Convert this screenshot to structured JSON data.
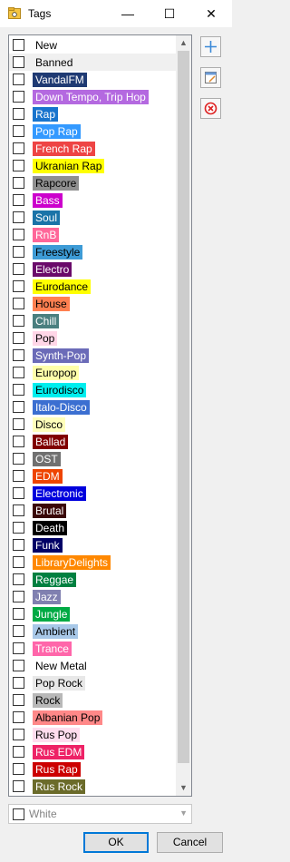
{
  "window": {
    "title": "Tags",
    "min_icon": "minimize-icon",
    "max_icon": "maximize-icon",
    "close_icon": "close-icon",
    "min_glyph": "—",
    "max_glyph": "☐",
    "close_glyph": "✕"
  },
  "tags": [
    {
      "label": "New",
      "bg": "#ffffff",
      "fg": "#000000"
    },
    {
      "label": "Banned",
      "bg": "#f0f0f0",
      "fg": "#000000",
      "selected": true
    },
    {
      "label": "VandalFM",
      "bg": "#1f3a73",
      "fg": "#ffffff"
    },
    {
      "label": "Down Tempo, Trip Hop",
      "bg": "#b469e0",
      "fg": "#ffffff"
    },
    {
      "label": "Rap",
      "bg": "#1874cd",
      "fg": "#ffffff"
    },
    {
      "label": "Pop Rap",
      "bg": "#3399ff",
      "fg": "#ffffff"
    },
    {
      "label": "French Rap",
      "bg": "#ee4444",
      "fg": "#ffffff"
    },
    {
      "label": "Ukranian Rap",
      "bg": "#ffff00",
      "fg": "#000000"
    },
    {
      "label": "Rapcore",
      "bg": "#909090",
      "fg": "#000000"
    },
    {
      "label": "Bass",
      "bg": "#cc00cc",
      "fg": "#ffffff"
    },
    {
      "label": "Soul",
      "bg": "#1a73a8",
      "fg": "#ffffff"
    },
    {
      "label": "RnB",
      "bg": "#ff6699",
      "fg": "#ffffff"
    },
    {
      "label": "Freestyle",
      "bg": "#3d9bd6",
      "fg": "#000000"
    },
    {
      "label": "Electro",
      "bg": "#6a0a6a",
      "fg": "#ffffff"
    },
    {
      "label": "Eurodance",
      "bg": "#ffff00",
      "fg": "#000000"
    },
    {
      "label": "House",
      "bg": "#ff7f50",
      "fg": "#000000"
    },
    {
      "label": "Chill",
      "bg": "#4a7f7f",
      "fg": "#ffffff"
    },
    {
      "label": "Pop",
      "bg": "#ffd6e7",
      "fg": "#000000"
    },
    {
      "label": "Synth-Pop",
      "bg": "#6b6bb8",
      "fg": "#ffffff"
    },
    {
      "label": "Europop",
      "bg": "#ffffaa",
      "fg": "#000000"
    },
    {
      "label": "Eurodisco",
      "bg": "#00eeee",
      "fg": "#000000"
    },
    {
      "label": "Italo-Disco",
      "bg": "#3b6fd1",
      "fg": "#ffffff"
    },
    {
      "label": "Disco",
      "bg": "#ffffbb",
      "fg": "#000000"
    },
    {
      "label": "Ballad",
      "bg": "#800000",
      "fg": "#ffffff"
    },
    {
      "label": "OST",
      "bg": "#707070",
      "fg": "#ffffff"
    },
    {
      "label": "EDM",
      "bg": "#ee4400",
      "fg": "#ffffff"
    },
    {
      "label": "Electronic",
      "bg": "#0000dd",
      "fg": "#ffffff"
    },
    {
      "label": "Brutal",
      "bg": "#3a0808",
      "fg": "#ffffff"
    },
    {
      "label": "Death",
      "bg": "#000000",
      "fg": "#ffffff"
    },
    {
      "label": "Funk",
      "bg": "#000066",
      "fg": "#ffffff"
    },
    {
      "label": "LibraryDelights",
      "bg": "#ff8800",
      "fg": "#ffffff"
    },
    {
      "label": "Reggae",
      "bg": "#008040",
      "fg": "#ffffff"
    },
    {
      "label": "Jazz",
      "bg": "#8080b0",
      "fg": "#ffffff"
    },
    {
      "label": "Jungle",
      "bg": "#00aa44",
      "fg": "#ffffff"
    },
    {
      "label": "Ambient",
      "bg": "#a8c8e8",
      "fg": "#000000"
    },
    {
      "label": "Trance",
      "bg": "#ff66aa",
      "fg": "#ffffff"
    },
    {
      "label": "New Metal",
      "bg": "#ffffff",
      "fg": "#000000"
    },
    {
      "label": "Pop Rock",
      "bg": "#e8e8e8",
      "fg": "#000000"
    },
    {
      "label": "Rock",
      "bg": "#b8b8b8",
      "fg": "#000000"
    },
    {
      "label": "Albanian Pop",
      "bg": "#ff8888",
      "fg": "#000000"
    },
    {
      "label": "Rus Pop",
      "bg": "#ffddee",
      "fg": "#000000"
    },
    {
      "label": "Rus EDM",
      "bg": "#ee2266",
      "fg": "#ffffff"
    },
    {
      "label": "Rus Rap",
      "bg": "#cc0000",
      "fg": "#ffffff"
    },
    {
      "label": "Rus Rock",
      "bg": "#6b6b2a",
      "fg": "#ffffff"
    }
  ],
  "side_buttons": [
    "add-icon",
    "edit-icon",
    "delete-icon"
  ],
  "color_combo": {
    "value": "White"
  },
  "buttons": {
    "ok": "OK",
    "cancel": "Cancel"
  }
}
